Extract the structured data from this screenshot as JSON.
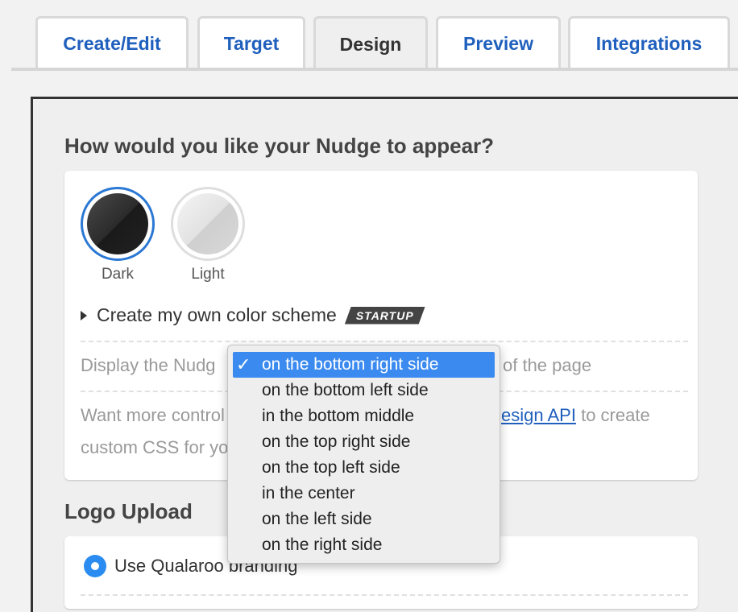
{
  "tabs": [
    {
      "label": "Create/Edit",
      "active": false
    },
    {
      "label": "Target",
      "active": false
    },
    {
      "label": "Design",
      "active": true
    },
    {
      "label": "Preview",
      "active": false
    },
    {
      "label": "Integrations",
      "active": false
    }
  ],
  "appearance": {
    "title": "How would you like your Nudge to appear?",
    "swatches": [
      {
        "label": "Dark",
        "selected": true
      },
      {
        "label": "Light",
        "selected": false
      }
    ],
    "custom_scheme": {
      "label": "Create my own color scheme",
      "badge": "STARTUP"
    },
    "display": {
      "prefix": "Display the Nudg",
      "suffix": "of the page"
    },
    "api_note": {
      "line1_prefix": "Want more control",
      "link": "esign API",
      "line1_suffix": "to create",
      "line2": "custom CSS for yo"
    }
  },
  "logo": {
    "title": "Logo Upload",
    "option_label": "Use Qualaroo branding"
  },
  "dropdown": {
    "selected_index": 0,
    "options": [
      "on the bottom right side",
      "on the bottom left side",
      "in the bottom middle",
      "on the top right side",
      "on the top left side",
      "in the center",
      "on the left side",
      "on the right side"
    ]
  },
  "colors": {
    "accent": "#1f5fbd",
    "selection": "#3b8af0",
    "radio": "#2a8cf0"
  }
}
